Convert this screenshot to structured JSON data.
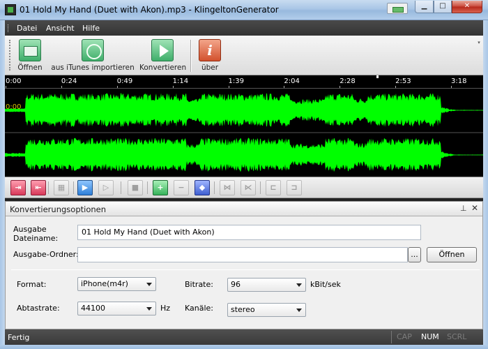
{
  "window": {
    "title": "01 Hold My Hand (Duet with Akon).mp3 - KlingeltonGenerator",
    "minimize_glyph": "▁",
    "maximize_glyph": "□",
    "close_glyph": "✕"
  },
  "menu": {
    "items": [
      "Datei",
      "Ansicht",
      "Hilfe"
    ]
  },
  "toolbar": {
    "open_label": "Öffnen",
    "itunes_label": "aus iTunes importieren",
    "convert_label": "Konvertieren",
    "about_label": "über",
    "about_glyph": "i",
    "scroll_glyph": "▾"
  },
  "timeline": {
    "ticks": [
      "0:00",
      "0:24",
      "0:49",
      "1:14",
      "1:39",
      "2:04",
      "2:28",
      "2:53",
      "3:18"
    ],
    "cursor_time": "0:00"
  },
  "waveform": {
    "color": "#00ff00",
    "background": "#000000"
  },
  "transport": {
    "buttons": [
      {
        "name": "set-start-button",
        "glyph": "⇥",
        "style": "red"
      },
      {
        "name": "set-end-button",
        "glyph": "⇤",
        "style": "red"
      },
      {
        "name": "select-all-button",
        "glyph": "▦",
        "style": "dim"
      },
      {
        "name": "play-button",
        "glyph": "▶",
        "style": "blue"
      },
      {
        "name": "play-selection-button",
        "glyph": "▷",
        "style": "dim"
      },
      {
        "name": "stop-button",
        "glyph": "■",
        "style": "dim"
      },
      {
        "name": "zoom-in-button",
        "glyph": "+",
        "style": "green"
      },
      {
        "name": "zoom-out-button",
        "glyph": "−",
        "style": "dim"
      },
      {
        "name": "zoom-fit-button",
        "glyph": "◆",
        "style": "navy"
      },
      {
        "name": "fade-in-button",
        "glyph": "⋈",
        "style": "dim"
      },
      {
        "name": "fade-out-button",
        "glyph": "⋉",
        "style": "dim"
      },
      {
        "name": "trim-left-button",
        "glyph": "⊏",
        "style": "dim"
      },
      {
        "name": "trim-right-button",
        "glyph": "⊐",
        "style": "dim"
      }
    ]
  },
  "options": {
    "title": "Konvertierungsoptionen",
    "pin_glyph": "⊥",
    "close_glyph": "✕",
    "filename_label_line1": "Ausgabe",
    "filename_label_line2": "Dateiname:",
    "filename_value": "01 Hold My Hand (Duet with Akon)",
    "folder_label": "Ausgabe-Ordner:",
    "folder_value": "",
    "browse_label": "...",
    "open_folder_label": "Öffnen",
    "format_label": "Format:",
    "format_value": "iPhone(m4r)",
    "bitrate_label": "Bitrate:",
    "bitrate_value": "96",
    "bitrate_unit": "kBit/sek",
    "samplerate_label": "Abtastrate:",
    "samplerate_value": "44100",
    "samplerate_unit": "Hz",
    "channels_label": "Kanäle:",
    "channels_value": "stereo"
  },
  "status": {
    "text": "Fertig",
    "cap": "CAP",
    "num": "NUM",
    "scrl": "SCRL"
  }
}
